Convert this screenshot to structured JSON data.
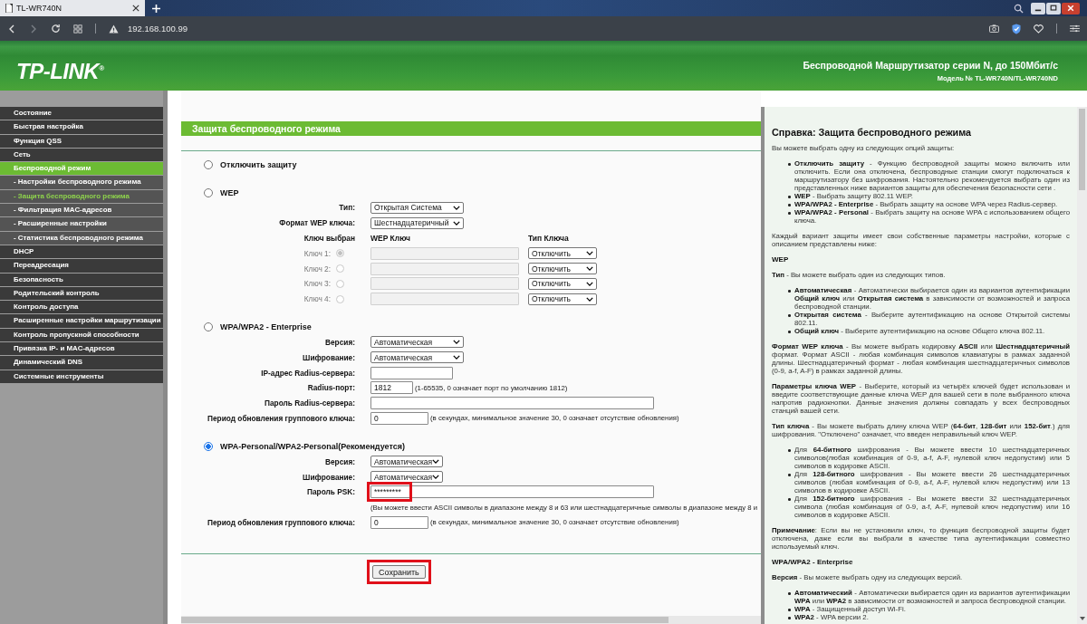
{
  "browser": {
    "tab_title": "TL-WR740N",
    "url": "192.168.100.99"
  },
  "header": {
    "logo": "TP-LINK$^{®}$",
    "title": "Беспроводной Маршрутизатор серии N, до 150Мбит/с",
    "model": "Модель № TL-WR740N/TL-WR740ND"
  },
  "sidebar": [
    {
      "label": "Состояние",
      "kind": "section",
      "selected": false
    },
    {
      "label": "Быстрая настройка",
      "kind": "section",
      "selected": false
    },
    {
      "label": "Функция QSS",
      "kind": "section",
      "selected": false
    },
    {
      "label": "Сеть",
      "kind": "section",
      "selected": false
    },
    {
      "label": "Беспроводной режим",
      "kind": "section",
      "selected": true
    },
    {
      "label": "- Настройки беспроводного режима",
      "kind": "sub",
      "selected": false
    },
    {
      "label": "- Защита беспроводного режима",
      "kind": "sub",
      "selected": true
    },
    {
      "label": "- Фильтрация MAC-адресов",
      "kind": "sub",
      "selected": false
    },
    {
      "label": "- Расширенные настройки",
      "kind": "sub",
      "selected": false
    },
    {
      "label": "- Статистика беспроводного режима",
      "kind": "sub",
      "selected": false
    },
    {
      "label": "DHCP",
      "kind": "section",
      "selected": false
    },
    {
      "label": "Переадресация",
      "kind": "section",
      "selected": false
    },
    {
      "label": "Безопасность",
      "kind": "section",
      "selected": false
    },
    {
      "label": "Родительский контроль",
      "kind": "section",
      "selected": false
    },
    {
      "label": "Контроль доступа",
      "kind": "section",
      "selected": false
    },
    {
      "label": "Расширенные настройки маршрутизации",
      "kind": "section",
      "selected": false
    },
    {
      "label": "Контроль пропускной способности",
      "kind": "section",
      "selected": false
    },
    {
      "label": "Привязка IP- и MAC-адресов",
      "kind": "section",
      "selected": false
    },
    {
      "label": "Динамический DNS",
      "kind": "section",
      "selected": false
    },
    {
      "label": "Системные инструменты",
      "kind": "section",
      "selected": false
    }
  ],
  "form": {
    "title": "Защита беспроводного режима",
    "options": [
      {
        "label": "Отключить защиту",
        "selected": false
      },
      {
        "label": "WEP",
        "selected": false,
        "fields": [
          {
            "kind": "select",
            "label": "Тип:",
            "value": "Открытая Система"
          },
          {
            "kind": "select",
            "label": "Формат WEP ключа:",
            "value": "Шестнадцатеричный"
          }
        ],
        "key_table": {
          "headers": [
            "Ключ выбран",
            "WEP Ключ",
            "Тип Ключа"
          ],
          "keys": [
            {
              "label": "Ключ 1:",
              "selected": true,
              "disabled": true,
              "type": "Отключить"
            },
            {
              "label": "Ключ 2:",
              "selected": false,
              "disabled": true,
              "type": "Отключить"
            },
            {
              "label": "Ключ 3:",
              "selected": false,
              "disabled": true,
              "type": "Отключить"
            },
            {
              "label": "Ключ 4:",
              "selected": false,
              "disabled": true,
              "type": "Отключить"
            }
          ]
        }
      },
      {
        "label": "WPA/WPA2 - Enterprise",
        "selected": false,
        "fields": [
          {
            "kind": "select",
            "label": "Версия:",
            "value": "Автоматическая"
          },
          {
            "kind": "select",
            "label": "Шифрование:",
            "value": "Автоматическая"
          },
          {
            "kind": "medium",
            "label": "IP-адрес Radius-сервера:"
          },
          {
            "kind": "port",
            "label": "Radius-порт:",
            "value": "1812",
            "note": "(1-65535, 0 означает порт по умолчанию 1812)"
          },
          {
            "kind": "wide",
            "label": "Пароль Radius-сервера:"
          },
          {
            "kind": "short",
            "label": "Период обновления группового ключа:",
            "value": "0",
            "note": "(в секундах, минимальное значение 30, 0 означает отсутствие обновления)"
          }
        ]
      },
      {
        "label": "WPA-Personal/WPA2-Personal(Рекомендуется)",
        "selected": true,
        "fields": [
          {
            "kind": "smallselect",
            "label": "Версия:",
            "value": "Автоматическая"
          },
          {
            "kind": "smallselect",
            "label": "Шифрование:",
            "value": "Автоматическая"
          },
          {
            "kind": "wide",
            "label": "Пароль PSK:",
            "value": "*********",
            "highlighted": true,
            "hint": "(Вы можете ввести ASCII символы в диапазоне между 8 и 63 или шестнадцатеричные символы в диапазоне между 8 и"
          },
          {
            "kind": "short",
            "label": "Период обновления группового ключа:",
            "value": "0",
            "note": "(в секундах, минимальное значение 30, 0 означает отсутствие обновления)"
          }
        ]
      }
    ],
    "save_button": {
      "label": "Сохранить",
      "highlighted": true
    }
  },
  "help": [
    {
      "kind": "title",
      "text": "Справка: Защита беспроводного режима"
    },
    {
      "kind": "para",
      "text": "Вы можете выбрать одну из следующих опций защиты:"
    },
    {
      "kind": "list",
      "items": [
        "**Отключить защиту** - Функцию беспроводной защиты можно включить или отключить. Если она отключена, беспроводные станции смогут подключаться к маршрутизатору без шифрования. Настоятельно рекомендуется выбрать один из представленных ниже вариантов защиты для обеспечения безопасности сети .",
        "**WEP** - Выбрать защиту 802.11 WEP.",
        "**WPA/WPA2 - Enterprise** - Выбрать защиту на основе WPA через Radius-сервер.",
        "**WPA/WPA2 - Personal** - Выбрать защиту на основе WPA с использованием общего ключа."
      ]
    },
    {
      "kind": "para",
      "text": "Каждый вариант защиты имеет свои собственные параметры настройки, которые с описанием представлены ниже:"
    },
    {
      "kind": "heading",
      "text": "WEP"
    },
    {
      "kind": "para",
      "text": "**Тип** - Вы можете выбрать один из следующих типов."
    },
    {
      "kind": "list",
      "items": [
        "**Автоматическая** - Автоматически выбирается один из вариантов аутентификации **Общий ключ** или **Открытая система** в зависимости от возможностей и запроса беспроводной станции.",
        "**Открытая система** - Выберите аутентификацию на основе Открытой системы 802.11.",
        "**Общий ключ** - Выберите аутентификацию на основе Общего ключа 802.11."
      ]
    },
    {
      "kind": "para",
      "text": "**Формат WEP ключа** - Вы можете выбрать кодировку **ASCII** или **Шестнадцатеричный** формат. Формат ASCII - любая комбинация символов клавиатуры в рамках заданной длины. Шестнадцатеричный формат - любая комбинация шестнадцатеричных символов (0-9, a-f, A-F) в рамках заданной длины."
    },
    {
      "kind": "para",
      "text": "**Параметры ключа WEP** - Выберите, который из четырёх ключей будет использован и введите соответствующие данные ключа WEP для вашей сети в поле выбранного ключа напротив радиокнопки. Данные значения должны совпадать у всех беспроводных станций вашей сети."
    },
    {
      "kind": "para",
      "text": "**Тип ключа** - Вы можете выбрать длину ключа WEP (**64-бит**, **128-бит** или **152-бит**.) для шифрования. \"Отключено\" означает, что введен неправильный ключ WEP."
    },
    {
      "kind": "list",
      "items": [
        "Для **64-битного** шифрования - Вы можете ввести 10 шестнадцатеричных символов(любая комбинация of 0-9, a-f, A-F, нулевой ключ недопустим) или 5 символов в кодировке ASCII.",
        "Для **128-битного** шифрования - Вы можете ввести 26 шестнадцатеричных символов (любая комбинация of 0-9, a-f, A-F, нулевой ключ недопустим) или 13 символов в кодировке ASCII.",
        "Для **152-битного** шифрования - Вы можете ввести 32 шестнадцатеричных символа (любая комбинация of 0-9, a-f, A-F, нулевой ключ недопустим) или 16 символов в кодировке ASCII."
      ]
    },
    {
      "kind": "para",
      "text": "**Примечание**: Если вы не установили ключ, то функция беспроводной защиты будет отключена, даже если вы выбрали в качестве типа аутентификации совместно используемый ключ."
    },
    {
      "kind": "heading",
      "text": "WPA/WPA2 - Enterprise"
    },
    {
      "kind": "para",
      "text": "**Версия** -  Вы можете выбрать одну из следующих версий."
    },
    {
      "kind": "list",
      "items": [
        "**Автоматический** - Автоматически выбирается один из вариантов аутентификации **WPA** или **WPA2** в зависимости от возможностей и запроса беспроводной станции.",
        "**WPA** - Защищенный доступ Wi-Fi.",
        "**WPA2** - WPA версии 2."
      ]
    }
  ]
}
